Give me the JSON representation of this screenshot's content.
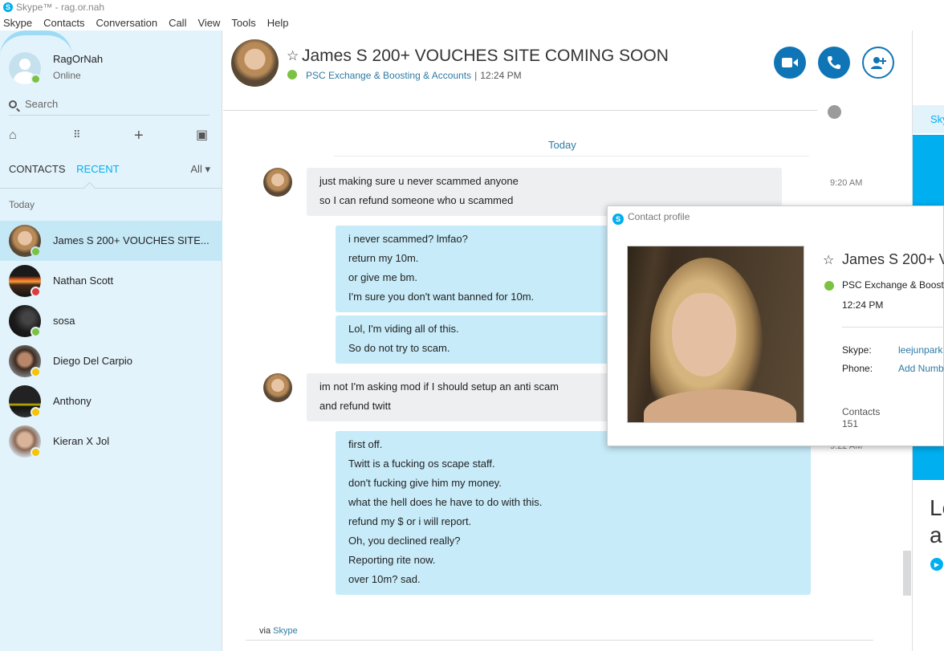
{
  "window": {
    "title": "Skype™ - rag.or.nah"
  },
  "menu": [
    "Skype",
    "Contacts",
    "Conversation",
    "Call",
    "View",
    "Tools",
    "Help"
  ],
  "me": {
    "name": "RagOrNah",
    "status": "Online"
  },
  "search": {
    "placeholder": "Search"
  },
  "tabs": {
    "contacts": "CONTACTS",
    "recent": "RECENT",
    "filter": "All"
  },
  "recent_group": "Today",
  "contacts": [
    {
      "name": "James S 200+ VOUCHES SITE...",
      "status": "online",
      "active": true
    },
    {
      "name": "Nathan Scott",
      "status": "busy"
    },
    {
      "name": "sosa",
      "status": "online"
    },
    {
      "name": "Diego Del Carpio",
      "status": "away"
    },
    {
      "name": "Anthony",
      "status": "away"
    },
    {
      "name": "Kieran X Jol",
      "status": "away"
    }
  ],
  "conversation": {
    "title": "James S 200+ VOUCHES SITE COMING SOON",
    "mood": "PSC Exchange & Boosting & Accounts",
    "time": "12:24 PM",
    "day_label": "Today",
    "messages": [
      {
        "dir": "in",
        "lines": [
          "just making sure u never scammed anyone",
          "so I can refund someone who u scammed"
        ],
        "time": "9:20 AM"
      },
      {
        "dir": "out",
        "lines": [
          "i never scammed? lmfao?",
          "return my 10m.",
          "or give me bm.",
          "I'm sure you don't want banned for 10m."
        ]
      },
      {
        "dir": "out",
        "lines": [
          "Lol, I'm viding all of this.",
          "So do not try to scam."
        ]
      },
      {
        "dir": "in",
        "lines": [
          "im not I'm asking mod if I should setup an anti scam",
          "and refund twitt"
        ]
      },
      {
        "dir": "out",
        "lines": [
          "first off.",
          "Twitt is a fucking os scape staff.",
          "don't fucking give him my money.",
          "what the hell does he have to do with this.",
          "refund my $ or i will report.",
          "Oh, you declined really?",
          "Reporting rite now.",
          "over 10m? sad."
        ],
        "time": "9:22 AM"
      }
    ],
    "via_prefix": "via",
    "via_link": "Skype"
  },
  "right_pane": {
    "tab": "Sky",
    "big_text_1": "Le",
    "big_text_2": "a"
  },
  "popup": {
    "title": "Contact profile",
    "name": "James S 200+ V",
    "mood": "PSC Exchange & Boostin",
    "time": "12:24 PM",
    "skype_label": "Skype:",
    "skype_value": "leejunpark",
    "phone_label": "Phone:",
    "phone_value": "Add Numb",
    "contacts_label": "Contacts",
    "contacts_count": "151"
  },
  "colors": {
    "accent": "#00aff0",
    "call_button": "#0f75b6",
    "online": "#7cc242",
    "busy": "#e03a3e",
    "away": "#f8c300"
  }
}
